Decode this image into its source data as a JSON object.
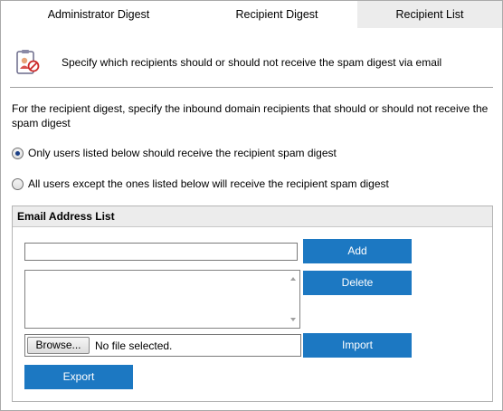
{
  "tabs": [
    {
      "label": "Administrator Digest",
      "active": false
    },
    {
      "label": "Recipient Digest",
      "active": false
    },
    {
      "label": "Recipient List",
      "active": true
    }
  ],
  "header": {
    "icon": "clipboard-users-icon",
    "text": "Specify which recipients should or should not receive the spam digest via email"
  },
  "description": "For the recipient digest, specify the inbound domain recipients that should or should not receive the spam digest",
  "radios": [
    {
      "label": "Only users listed below should receive the recipient spam digest",
      "checked": true
    },
    {
      "label": "All users except the ones listed below will receive the recipient spam digest",
      "checked": false
    }
  ],
  "email_list": {
    "title": "Email Address List",
    "input_value": "",
    "items": [],
    "add_label": "Add",
    "delete_label": "Delete",
    "browse_label": "Browse...",
    "file_status": "No file selected.",
    "import_label": "Import",
    "export_label": "Export"
  },
  "colors": {
    "button_blue": "#1c78c2",
    "active_tab": "#ececec",
    "panel_header": "#ececec"
  }
}
